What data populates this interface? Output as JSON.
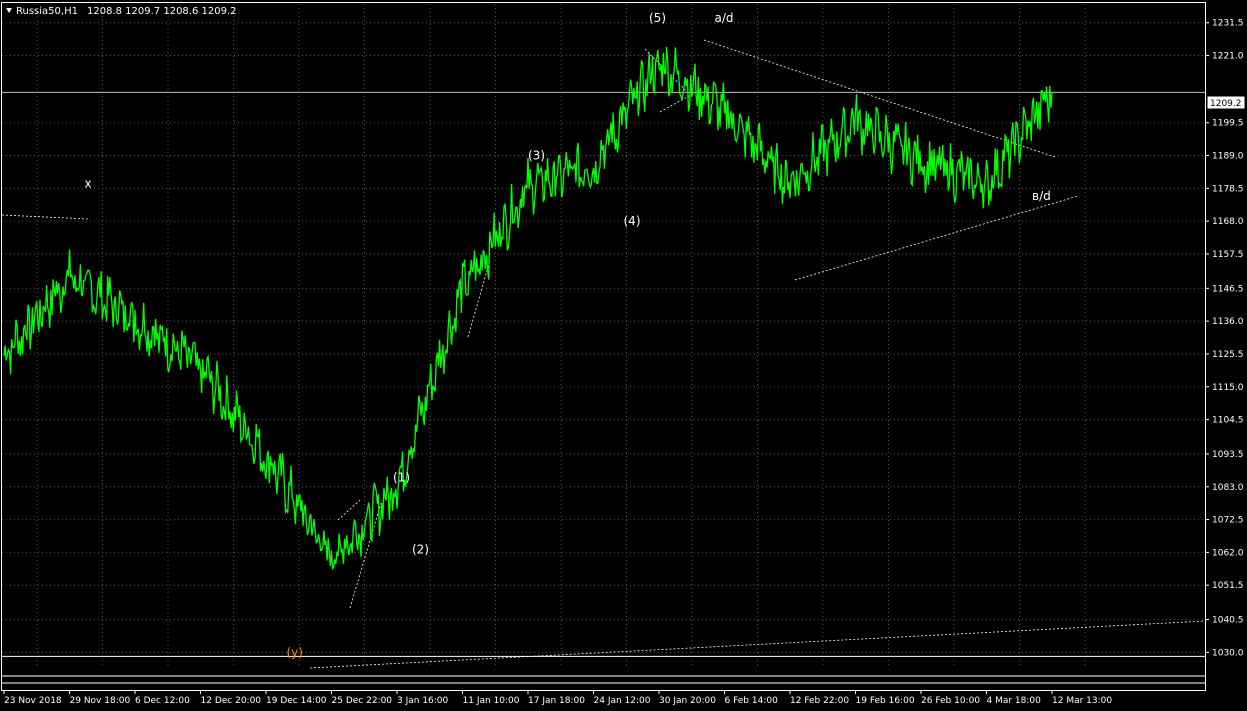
{
  "header": {
    "symbol_timeframe": "Russia50,H1",
    "ohlc": "1208.8 1209.7 1208.6 1209.2"
  },
  "colors": {
    "background": "#000000",
    "price_line": "#00FF00",
    "grid": "#555555",
    "text": "#FFFFFF",
    "y_label": "#FF8C00"
  },
  "current_price_label": "1209.2",
  "chart_data": {
    "type": "line",
    "title": "",
    "xlabel": "",
    "ylabel": "",
    "grid": true,
    "ylim": [
      1025.0,
      1237.5
    ],
    "y_ticks": [
      "1231.5",
      "1221.0",
      "1209.2",
      "1199.5",
      "1189.0",
      "1178.5",
      "1168.0",
      "1157.5",
      "1146.5",
      "1136.0",
      "1125.5",
      "1115.0",
      "1104.5",
      "1093.5",
      "1083.0",
      "1072.5",
      "1062.0",
      "1051.5",
      "1040.5",
      "1030.0"
    ],
    "x_tick_labels": [
      "23 Nov 2018",
      "29 Nov 18:00",
      "6 Dec 12:00",
      "12 Dec 20:00",
      "19 Dec 14:00",
      "25 Dec 22:00",
      "3 Jan 16:00",
      "11 Jan 10:00",
      "17 Jan 18:00",
      "24 Jan 12:00",
      "30 Jan 20:00",
      "6 Feb 14:00",
      "12 Feb 22:00",
      "19 Feb 16:00",
      "26 Feb 10:00",
      "4 Mar 18:00",
      "12 Mar 13:00"
    ],
    "series": [
      {
        "x": [
          "23 Nov 2018",
          "29 Nov 18:00",
          "6 Dec 12:00",
          "12 Dec 20:00",
          "19 Dec 14:00",
          "25 Dec 22:00",
          "3 Jan 16:00",
          "11 Jan 10:00",
          "17 Jan 18:00",
          "24 Jan 12:00",
          "30 Jan 20:00",
          "6 Feb 14:00",
          "12 Feb 22:00",
          "19 Feb 16:00",
          "26 Feb 10:00",
          "4 Mar 18:00",
          "12 Mar 13:00"
        ],
        "values": [
          1125,
          1150,
          1137,
          1121,
          1093,
          1060,
          1083,
          1146,
          1179,
          1186,
          1219,
          1203,
          1180,
          1200,
          1187,
          1180,
          1209.2
        ]
      }
    ],
    "annotations": [
      {
        "text": "x",
        "x": "29 Nov 18:00",
        "y": 1180
      },
      {
        "text": "(y)",
        "x": "25 Dec 22:00",
        "y": 1030
      },
      {
        "text": "(1)",
        "x": "3 Jan 16:00",
        "y": 1086
      },
      {
        "text": "(2)",
        "x": "3 Jan 16:00",
        "y": 1063
      },
      {
        "text": "(3)",
        "x": "17 Jan 18:00",
        "y": 1189
      },
      {
        "text": "(4)",
        "x": "24 Jan 12:00",
        "y": 1168
      },
      {
        "text": "(5)",
        "x": "30 Jan 20:00",
        "y": 1233
      },
      {
        "text": "a/d",
        "x": "6 Feb 14:00",
        "y": 1233
      },
      {
        "text": "в/d",
        "x": "12 Mar 13:00",
        "y": 1176
      }
    ]
  }
}
